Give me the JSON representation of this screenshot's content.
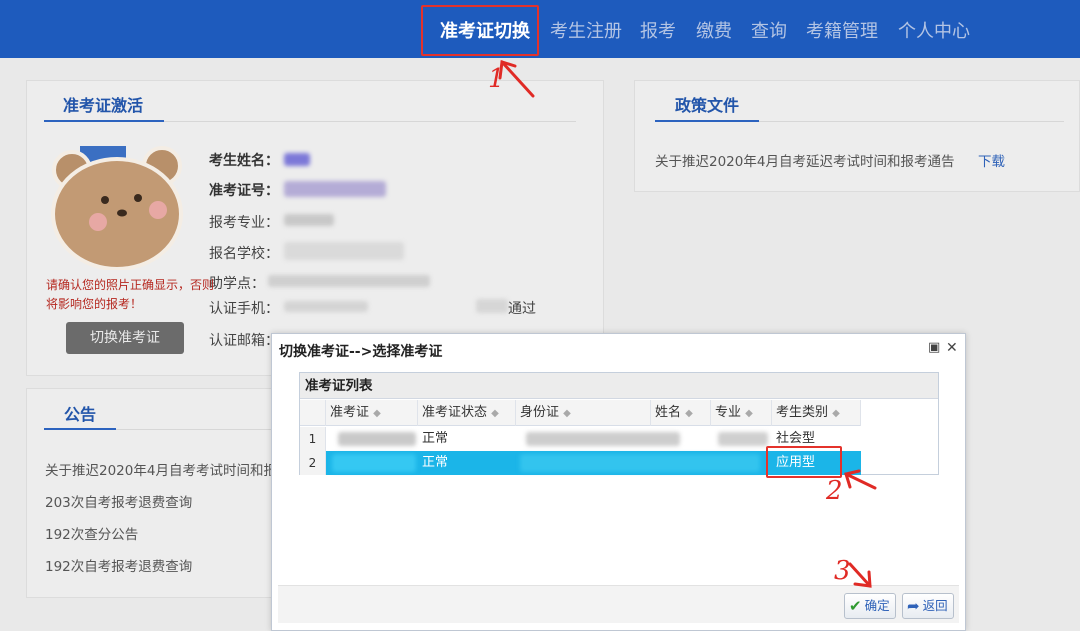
{
  "nav": {
    "items": [
      "准考证切换",
      "考生注册",
      "报考",
      "缴费",
      "查询",
      "考籍管理",
      "个人中心"
    ],
    "active_index": 0
  },
  "activation_panel": {
    "tab": "准考证激活",
    "fields": {
      "name_label": "考生姓名：",
      "ticket_label": "准考证号：",
      "major_label": "报考专业：",
      "school_label": "报名学校：",
      "assist_label": "助学点：",
      "phone_label": "认证手机：",
      "email_label": "认证邮箱："
    },
    "phone_status": "通过",
    "photo_warning": "请确认您的照片正确显示，否则将影响您的报考！",
    "switch_button": "切换准考证"
  },
  "policy_panel": {
    "tab": "政策文件",
    "items": [
      {
        "title": "关于推迟2020年4月自考延迟考试时间和报考通告",
        "action": "下载"
      }
    ]
  },
  "notice_panel": {
    "tab": "公告",
    "items": [
      "关于推迟2020年4月自考考试时间和报",
      "203次自考报考退费查询",
      "192次查分公告",
      "192次自考报考退费查询"
    ]
  },
  "dialog": {
    "title": "切换准考证-->选择准考证",
    "list_title": "准考证列表",
    "columns": [
      "准考证",
      "准考证状态",
      "身份证",
      "姓名",
      "专业",
      "考生类别"
    ],
    "rows": [
      {
        "num": "1",
        "status": "正常",
        "category": "社会型"
      },
      {
        "num": "2",
        "status": "正常",
        "category": "应用型",
        "selected": true
      }
    ],
    "confirm_button": "确定",
    "back_button": "返回"
  },
  "annotations": [
    "1",
    "2",
    "3"
  ],
  "colors": {
    "nav_bg": "#1e5bbd",
    "selected_row": "#1bb5e8",
    "annotation_red": "#e02a25",
    "link_blue": "#2f62b8"
  }
}
